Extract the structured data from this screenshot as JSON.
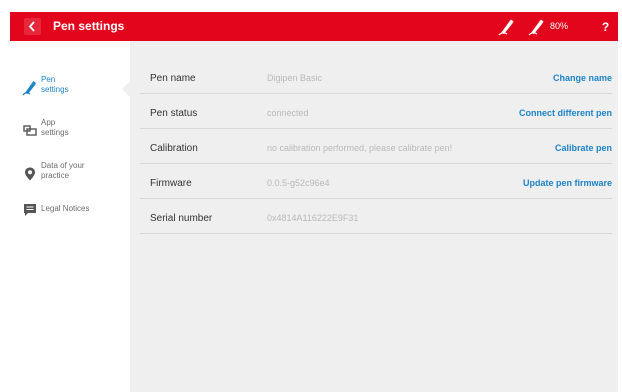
{
  "header": {
    "title": "Pen settings",
    "battery": "80%",
    "help_label": "?",
    "accent_color": "#e3051b"
  },
  "sidebar": {
    "items": [
      {
        "label_line1": "Pen",
        "label_line2": "settings",
        "icon": "pen-icon",
        "active": true
      },
      {
        "label_line1": "App",
        "label_line2": "settings",
        "icon": "app-settings-icon",
        "active": false
      },
      {
        "label_line1": "Data of your",
        "label_line2": "practice",
        "icon": "location-pin-icon",
        "active": false
      },
      {
        "label_line1": "Legal Notices",
        "label_line2": "",
        "icon": "message-icon",
        "active": false
      }
    ]
  },
  "rows": [
    {
      "label": "Pen name",
      "value": "Digipen Basic",
      "action": "Change name"
    },
    {
      "label": "Pen status",
      "value": "connected",
      "action": "Connect different pen"
    },
    {
      "label": "Calibration",
      "value": "no calibration performed, please calibrate pen!",
      "action": "Calibrate pen"
    },
    {
      "label": "Firmware",
      "value": "0.0.5-g52c96e4",
      "action": "Update pen firmware"
    },
    {
      "label": "Serial number",
      "value": "0x4814A116222E9F31",
      "action": ""
    }
  ],
  "colors": {
    "link": "#1c83c9",
    "content_bg": "#efefef"
  }
}
